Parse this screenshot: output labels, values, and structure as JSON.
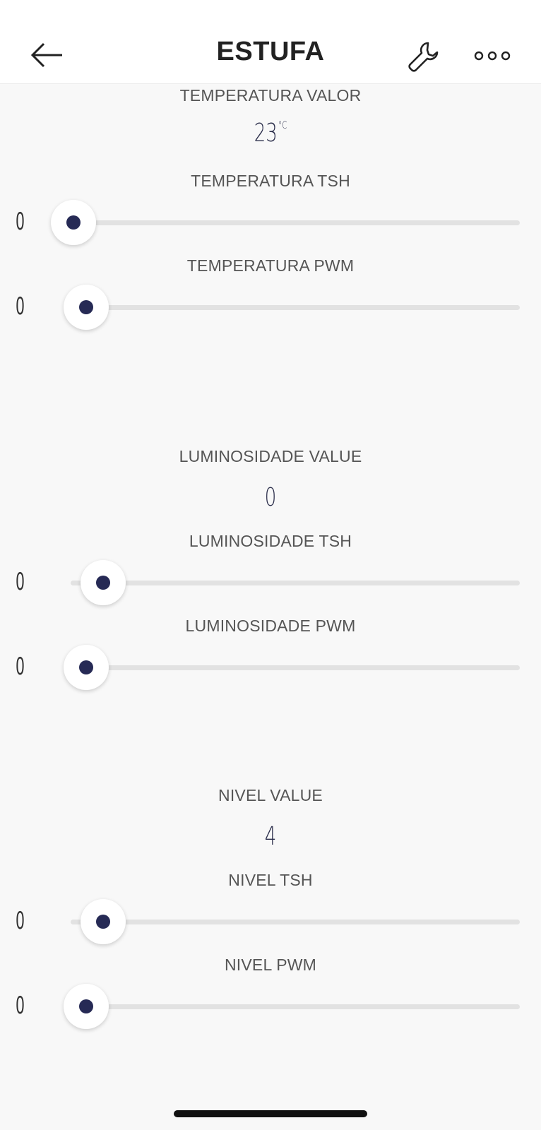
{
  "header": {
    "title": "ESTUFA",
    "back_icon": "arrow-left-icon",
    "settings_icon": "wrench-icon",
    "more_icon": "more-horizontal-icon"
  },
  "temperatura": {
    "value_label": "TEMPERATURA VALOR",
    "value": "23",
    "unit": "°C",
    "tsh_label": "TEMPERATURA TSH",
    "tsh_value": "0",
    "pwm_label": "TEMPERATURA PWM",
    "pwm_value": "0"
  },
  "luminosidade": {
    "value_label": "LUMINOSIDADE VALUE",
    "value": "0",
    "tsh_label": "LUMINOSIDADE TSH",
    "tsh_value": "0",
    "pwm_label": "LUMINOSIDADE PWM",
    "pwm_value": "0"
  },
  "nivel": {
    "value_label": "NIVEL VALUE",
    "value": "4",
    "tsh_label": "NIVEL TSH",
    "tsh_value": "0",
    "pwm_label": "NIVEL PWM",
    "pwm_value": "0"
  },
  "colors": {
    "thumb_dot": "#262a55",
    "track": "#e2e2e2",
    "background": "#f8f8f8"
  }
}
